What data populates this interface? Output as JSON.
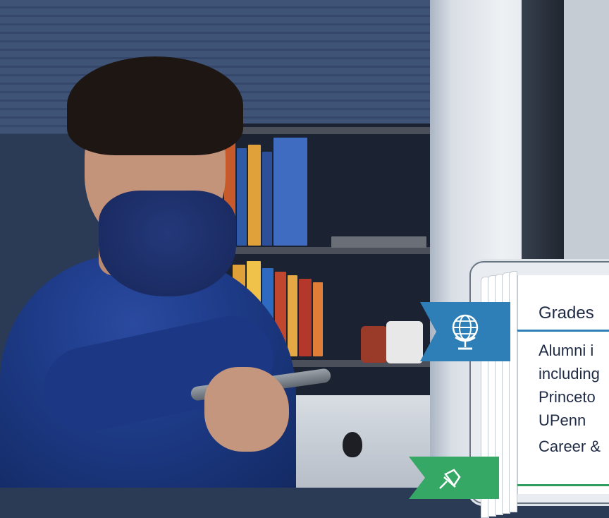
{
  "background": {
    "description_icon": "photo-icon"
  },
  "card": {
    "grades_heading": "Grades",
    "alumni_lines": [
      "Alumni i",
      "including",
      "Princeto",
      "UPenn"
    ],
    "career_heading": "Career &",
    "ribbon_top_icon": "globe-icon",
    "ribbon_bottom_icon": "pushpin-icon",
    "accent_blue": "#2e7fb8",
    "accent_green": "#35a866"
  }
}
